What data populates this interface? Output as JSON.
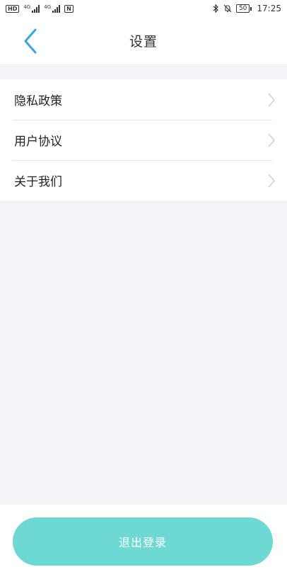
{
  "status_bar": {
    "hd_badge": "HD",
    "sim1_tag": "4G",
    "sim2_tag": "4G",
    "nfc_label": "N",
    "battery_level": "50",
    "time": "17:25",
    "icons": [
      "bluetooth-icon",
      "mute-icon"
    ]
  },
  "header": {
    "title": "设置",
    "back_icon": "chevron-left-icon",
    "accent_color": "#3aa6dd"
  },
  "settings": {
    "items": [
      {
        "label": "隐私政策"
      },
      {
        "label": "用户协议"
      },
      {
        "label": "关于我们"
      }
    ]
  },
  "footer": {
    "logout_label": "退出登录",
    "button_color": "#6ed8d3"
  }
}
